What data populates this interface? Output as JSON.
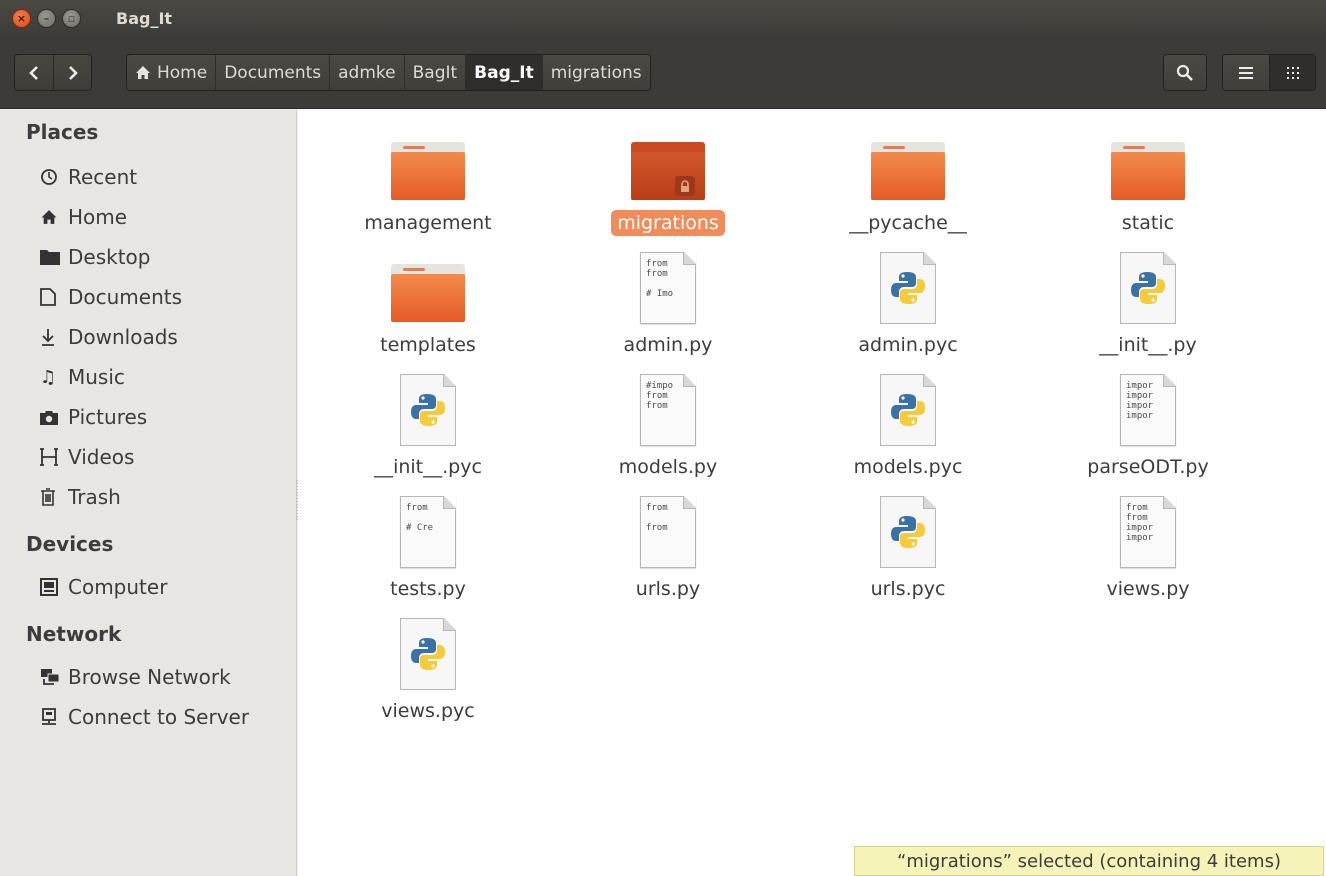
{
  "window": {
    "title": "Bag_It"
  },
  "toolbar": {
    "back_icon": "chevron-left-icon",
    "forward_icon": "chevron-right-icon",
    "breadcrumbs": [
      {
        "label": "Home",
        "icon": "home-icon"
      },
      {
        "label": "Documents"
      },
      {
        "label": "admke"
      },
      {
        "label": "BagIt"
      },
      {
        "label": "Bag_It",
        "active": true
      },
      {
        "label": "migrations"
      }
    ],
    "search_icon": "search-icon",
    "list_view_icon": "list-view-icon",
    "grid_view_icon": "grid-view-icon"
  },
  "sidebar": {
    "places_heading": "Places",
    "places": [
      {
        "label": "Recent",
        "icon": "clock-icon"
      },
      {
        "label": "Home",
        "icon": "home-icon"
      },
      {
        "label": "Desktop",
        "icon": "desktop-folder-icon"
      },
      {
        "label": "Documents",
        "icon": "document-icon"
      },
      {
        "label": "Downloads",
        "icon": "download-icon"
      },
      {
        "label": "Music",
        "icon": "music-icon"
      },
      {
        "label": "Pictures",
        "icon": "camera-icon"
      },
      {
        "label": "Videos",
        "icon": "film-icon"
      },
      {
        "label": "Trash",
        "icon": "trash-icon"
      }
    ],
    "devices_heading": "Devices",
    "devices": [
      {
        "label": "Computer",
        "icon": "computer-icon"
      }
    ],
    "network_heading": "Network",
    "network": [
      {
        "label": "Browse Network",
        "icon": "network-icon"
      },
      {
        "label": "Connect to Server",
        "icon": "server-icon"
      }
    ]
  },
  "files": [
    {
      "name": "management",
      "type": "folder"
    },
    {
      "name": "migrations",
      "type": "folder",
      "selected": true,
      "locked": true
    },
    {
      "name": "__pycache__",
      "type": "folder"
    },
    {
      "name": "static",
      "type": "folder"
    },
    {
      "name": "templates",
      "type": "folder"
    },
    {
      "name": "admin.py",
      "type": "text",
      "preview": "from\nfrom\n\n# Imo"
    },
    {
      "name": "admin.pyc",
      "type": "pyc"
    },
    {
      "name": "__init__.py",
      "type": "pyc"
    },
    {
      "name": "__init__.pyc",
      "type": "pyc"
    },
    {
      "name": "models.py",
      "type": "text",
      "preview": "#impo\nfrom\nfrom"
    },
    {
      "name": "models.pyc",
      "type": "pyc"
    },
    {
      "name": "parseODT.py",
      "type": "text",
      "preview": "impor\nimpor\nimpor\nimpor"
    },
    {
      "name": "tests.py",
      "type": "text",
      "preview": "from\n\n# Cre"
    },
    {
      "name": "urls.py",
      "type": "text",
      "preview": "from\n\nfrom"
    },
    {
      "name": "urls.pyc",
      "type": "pyc"
    },
    {
      "name": "views.py",
      "type": "text",
      "preview": "from\nfrom\nimpor\nimpor"
    },
    {
      "name": "views.pyc",
      "type": "pyc"
    }
  ],
  "status": {
    "text": "“migrations” selected  (containing 4 items)"
  },
  "colors": {
    "accent": "#f08c5a",
    "folder": "#e35b28",
    "titlebar": "#3c3b37",
    "status_bg": "#f6f3b9"
  }
}
